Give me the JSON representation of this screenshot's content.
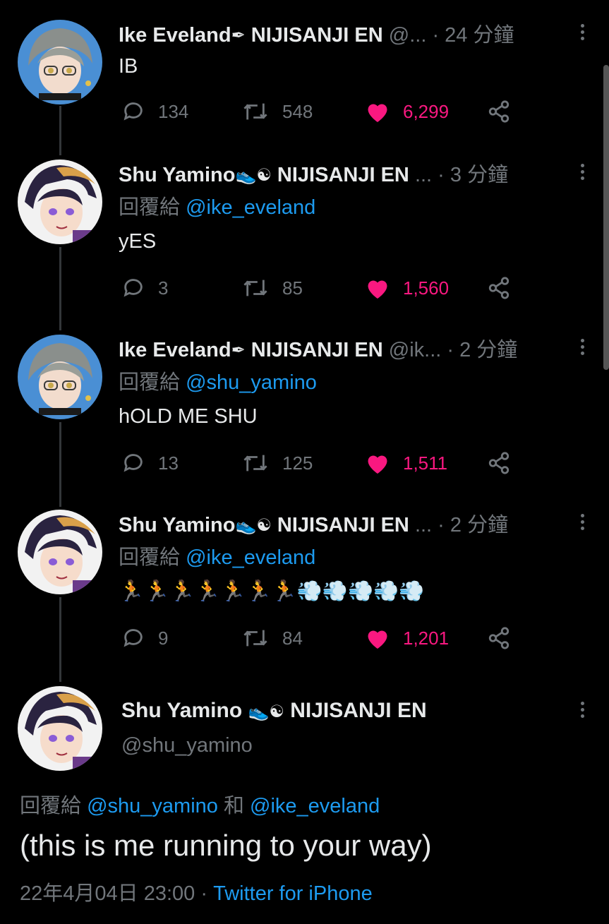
{
  "colors": {
    "background": "#000000",
    "text": "#e7e9ea",
    "muted": "#71767b",
    "link": "#1d9bf0",
    "like": "#f91880"
  },
  "tweets": [
    {
      "name": "Ike Eveland",
      "emojis": [
        "pen-icon"
      ],
      "suffix": "NIJISANJI EN",
      "handle": "@...",
      "time": "· 24 分鐘",
      "reply_label": "",
      "reply_to": "",
      "text": "IB",
      "replies": "134",
      "retweets": "548",
      "likes": "6,299"
    },
    {
      "name": "Shu Yamino",
      "emojis": [
        "sneaker-icon",
        "yin-yang-icon"
      ],
      "suffix": "NIJISANJI EN",
      "handle": "...",
      "time": "· 3 分鐘",
      "reply_label": "回覆給",
      "reply_to": "@ike_eveland",
      "text": "yES",
      "replies": "3",
      "retweets": "85",
      "likes": "1,560"
    },
    {
      "name": "Ike Eveland",
      "emojis": [
        "pen-icon"
      ],
      "suffix": "NIJISANJI EN",
      "handle": "@ik...",
      "time": "· 2 分鐘",
      "reply_label": "回覆給",
      "reply_to": "@shu_yamino",
      "text": "hOLD ME SHU",
      "replies": "13",
      "retweets": "125",
      "likes": "1,511"
    },
    {
      "name": "Shu Yamino",
      "emojis": [
        "sneaker-icon",
        "yin-yang-icon"
      ],
      "suffix": "NIJISANJI EN",
      "handle": "...",
      "time": "· 2 分鐘",
      "reply_label": "回覆給",
      "reply_to": "@ike_eveland",
      "text": "🏃🏃🏃🏃🏃🏃🏃💨💨💨💨💨",
      "replies": "9",
      "retweets": "84",
      "likes": "1,201"
    }
  ],
  "main_tweet": {
    "name": "Shu Yamino",
    "suffix": "NIJISANJI EN",
    "handle": "@shu_yamino",
    "reply_label": "回覆給",
    "reply_to_1": "@shu_yamino",
    "reply_and": "和",
    "reply_to_2": "@ike_eveland",
    "text": "(this is me running to your way)",
    "date": "22年4月04日 23:00",
    "separator": "·",
    "source": "Twitter for iPhone"
  }
}
